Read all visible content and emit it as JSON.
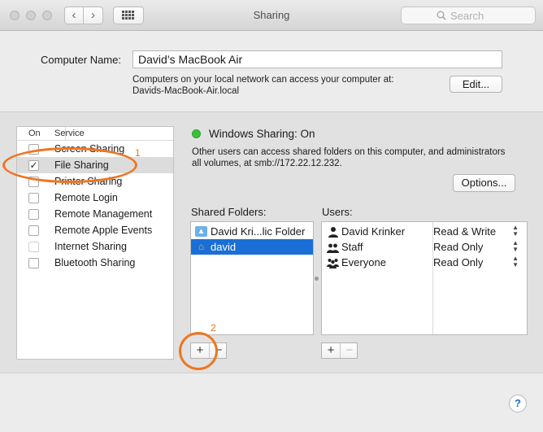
{
  "window": {
    "title": "Sharing",
    "search_placeholder": "Search"
  },
  "computer": {
    "label": "Computer Name:",
    "name": "David’s MacBook Air",
    "info_line1": "Computers on your local network can access your computer at:",
    "info_line2": "Davids-MacBook-Air.local",
    "edit_label": "Edit..."
  },
  "services": {
    "header_on": "On",
    "header_service": "Service",
    "items": [
      {
        "label": "Screen Sharing",
        "checked": false
      },
      {
        "label": "File Sharing",
        "checked": true,
        "selected": true
      },
      {
        "label": "Printer Sharing",
        "checked": false
      },
      {
        "label": "Remote Login",
        "checked": false
      },
      {
        "label": "Remote Management",
        "checked": false
      },
      {
        "label": "Remote Apple Events",
        "checked": false
      },
      {
        "label": "Internet Sharing",
        "checked": false,
        "disabled": true
      },
      {
        "label": "Bluetooth Sharing",
        "checked": false
      }
    ]
  },
  "status": {
    "text": "Windows Sharing: On",
    "color": "#3cc13b",
    "desc_line1": "Other users can access shared folders on this computer, and administrators",
    "desc_line2": "all volumes, at smb://172.22.12.232.",
    "options_label": "Options..."
  },
  "shared_folders": {
    "label": "Shared Folders:",
    "items": [
      {
        "name": "David Kri...lic Folder",
        "icon": "public-folder-icon"
      },
      {
        "name": "david",
        "icon": "home-folder-icon",
        "selected": true
      }
    ]
  },
  "users": {
    "label": "Users:",
    "items": [
      {
        "name": "David Krinker",
        "permission": "Read & Write",
        "icon": "user-icon"
      },
      {
        "name": "Staff",
        "permission": "Read Only",
        "icon": "group-icon"
      },
      {
        "name": "Everyone",
        "permission": "Read Only",
        "icon": "everyone-icon"
      }
    ]
  },
  "buttons": {
    "add": "+",
    "remove": "−"
  },
  "annotations": {
    "first": "1",
    "second": "2",
    "color": "#ee7622"
  },
  "help_label": "?"
}
